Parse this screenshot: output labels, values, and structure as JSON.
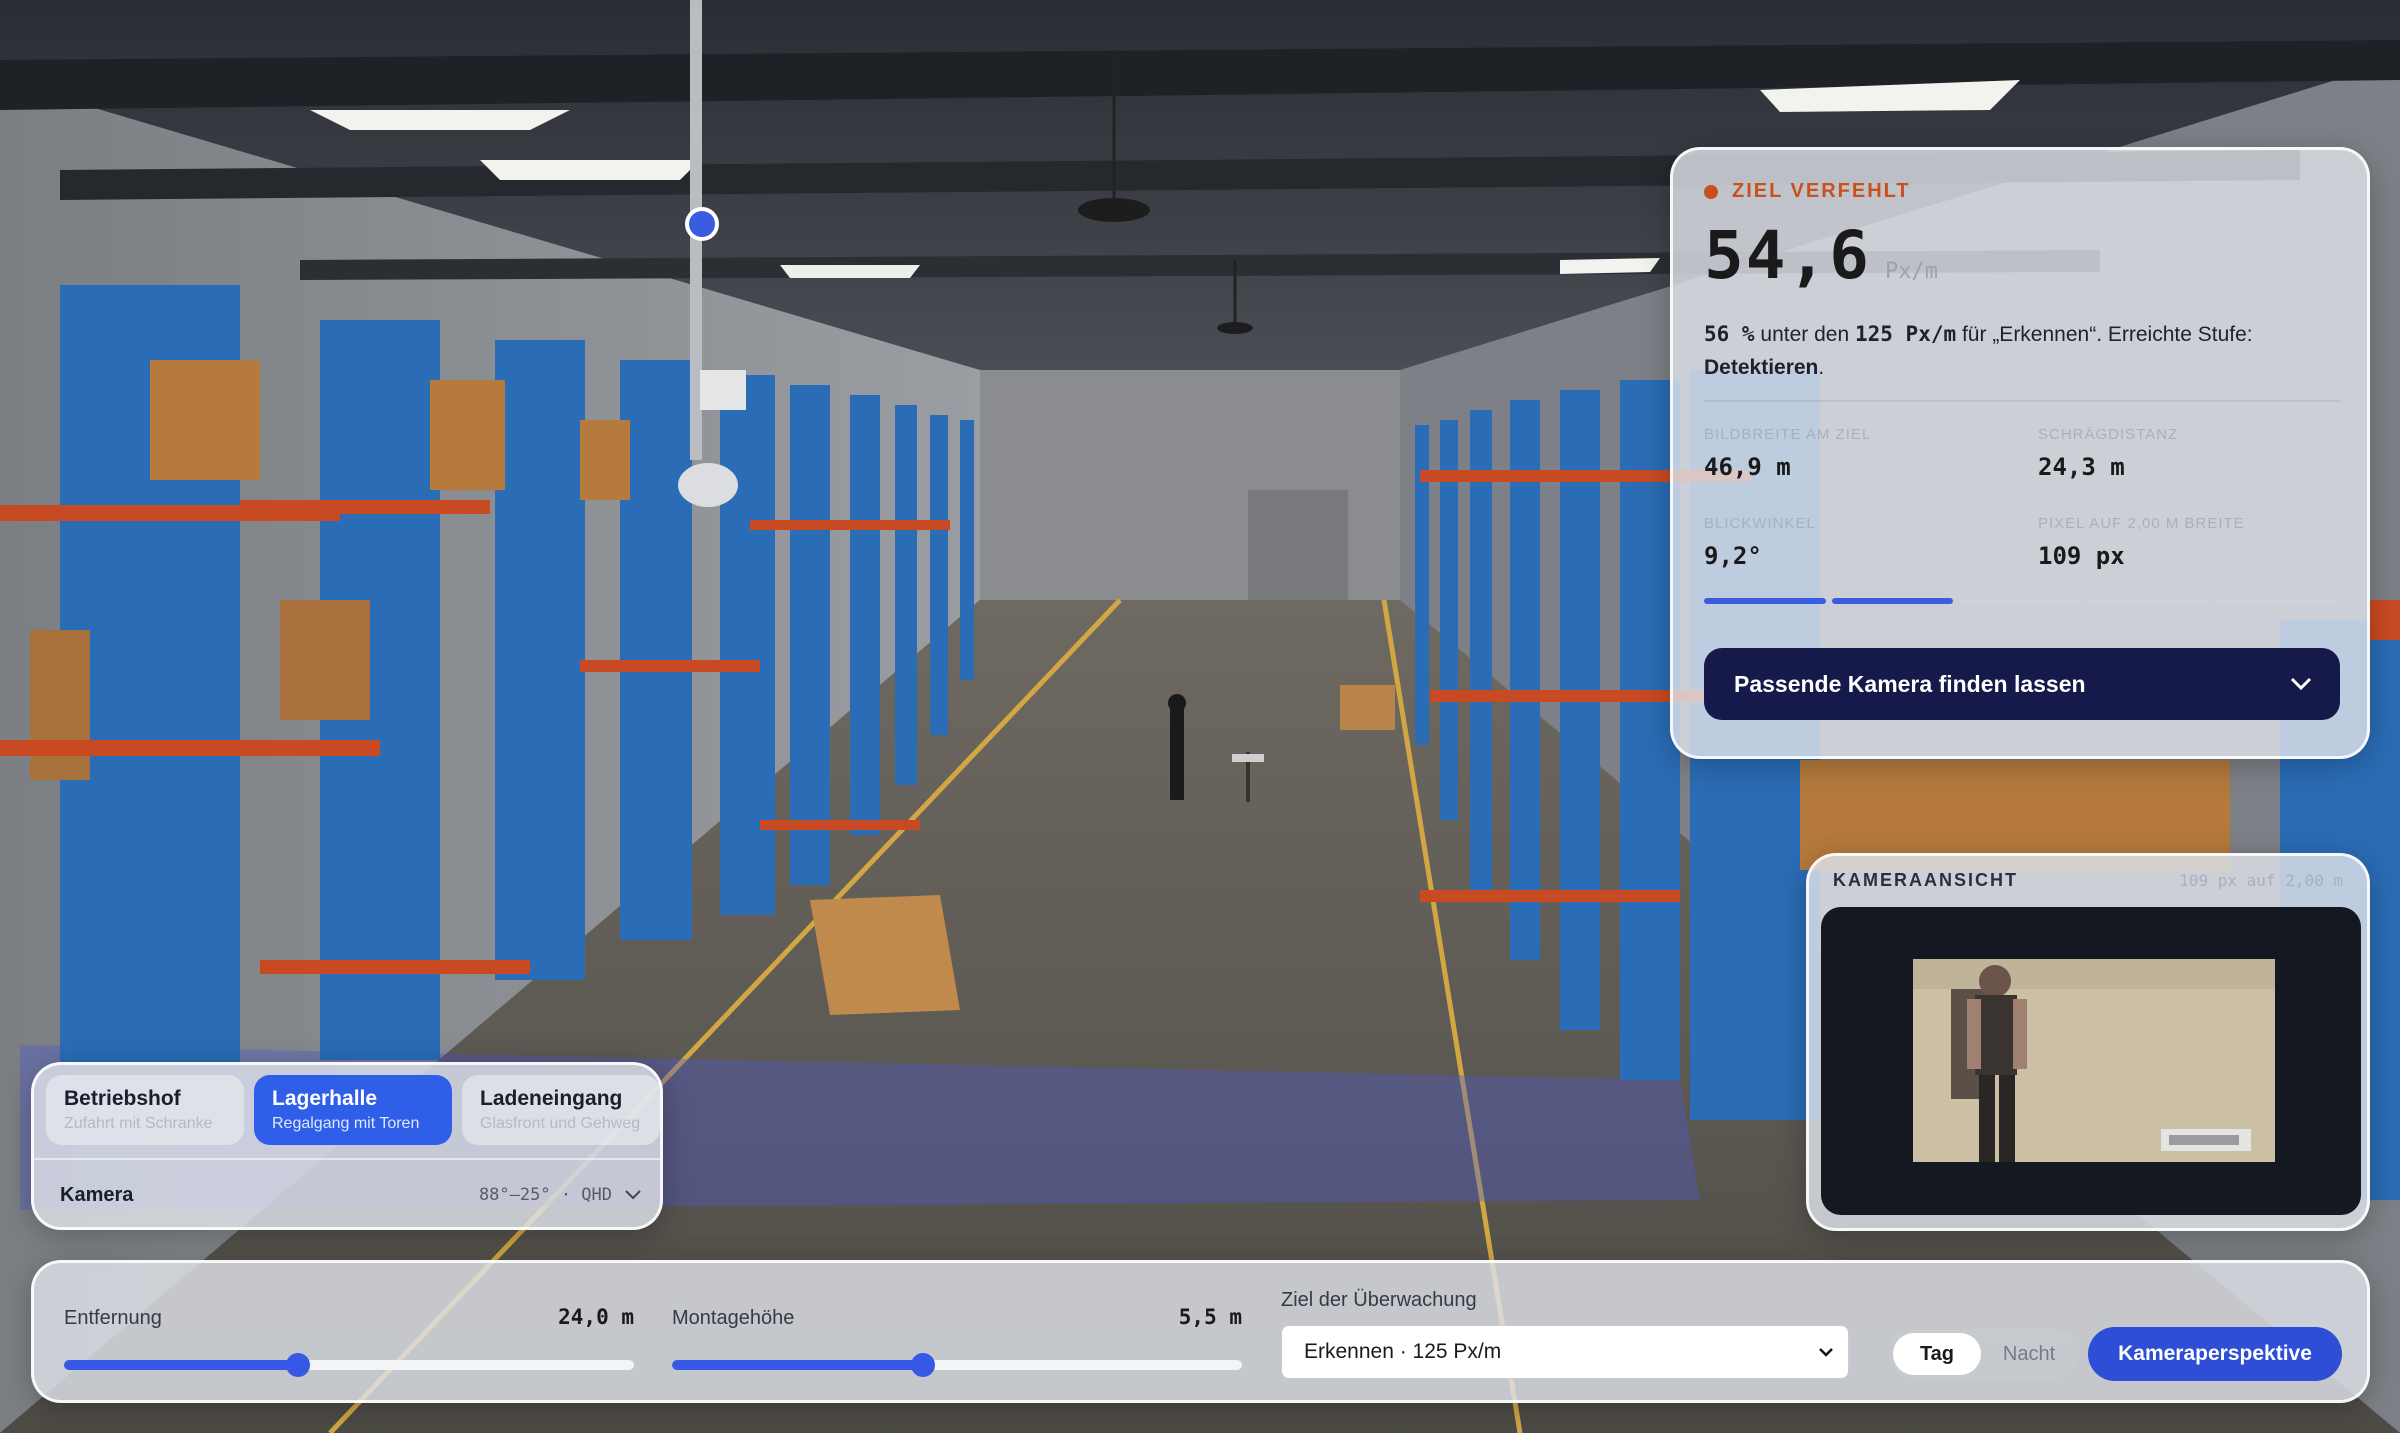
{
  "result": {
    "status": "ZIEL VERFEHLT",
    "value": "54,6",
    "unit": "Px/m",
    "summary_pct": "56 %",
    "summary_a": " unter den ",
    "summary_target": "125 Px/m",
    "summary_b": " für „Erkennen“. Erreichte Stufe: ",
    "summary_level": "Detektieren",
    "summary_end": ".",
    "metrics": [
      {
        "label": "Bildbreite am Ziel",
        "value": "46,9 m"
      },
      {
        "label": "Schrägdistanz",
        "value": "24,3 m"
      },
      {
        "label": "Blickwinkel",
        "value": "9,2°"
      },
      {
        "label": "Pixel auf 2,00 m Breite",
        "value": "109 px"
      }
    ],
    "level_segments_total": 5,
    "level_segments_on": 2,
    "find_camera_label": "Passende Kamera finden lassen"
  },
  "camera_view": {
    "title": "KAMERAANSICHT",
    "hint": "109 px auf 2,00 m"
  },
  "scenario": {
    "tabs": [
      {
        "name": "Betriebshof",
        "sub": "Zufahrt mit Schranke",
        "active": false
      },
      {
        "name": "Lagerhalle",
        "sub": "Regalgang mit Toren",
        "active": true
      },
      {
        "name": "Ladeneingang",
        "sub": "Glasfront und Gehweg",
        "active": false
      }
    ],
    "camera_label": "Kamera",
    "camera_value": "88°–25° · QHD"
  },
  "controls": {
    "distance": {
      "label": "Entfernung",
      "value": "24,0 m",
      "fraction": 0.41
    },
    "height": {
      "label": "Montagehöhe",
      "value": "5,5 m",
      "fraction": 0.44
    },
    "goal_label": "Ziel der Überwachung",
    "goal_value": "Erkennen · 125 Px/m",
    "day_label": "Tag",
    "night_label": "Nacht",
    "mode": "day",
    "perspective_label": "Kameraperspektive"
  },
  "colors": {
    "accent": "#3559e6",
    "status_fail": "#c9501c",
    "dark_button": "#151a4a"
  }
}
